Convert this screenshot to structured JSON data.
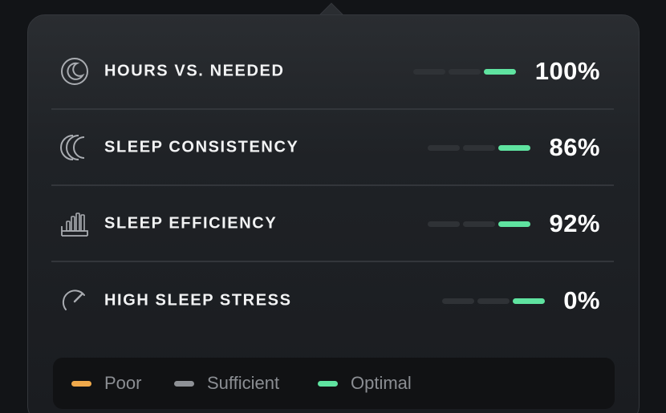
{
  "metrics": [
    {
      "label": "HOURS VS. NEEDED",
      "value": "100%",
      "icon": "moon-icon"
    },
    {
      "label": "SLEEP CONSISTENCY",
      "value": "86%",
      "icon": "double-moon-icon"
    },
    {
      "label": "SLEEP EFFICIENCY",
      "value": "92%",
      "icon": "bed-efficiency-icon"
    },
    {
      "label": "HIGH SLEEP STRESS",
      "value": "0%",
      "icon": "stress-gauge-icon"
    }
  ],
  "indicator": {
    "segments": 3,
    "active_segment": 3
  },
  "legend": [
    {
      "label": "Poor",
      "color": "#f0a94b"
    },
    {
      "label": "Sufficient",
      "color": "#8e9196"
    },
    {
      "label": "Optimal",
      "color": "#5fe3a0"
    }
  ],
  "colors": {
    "optimal": "#5fe3a0",
    "inactive": "#2f3236"
  }
}
